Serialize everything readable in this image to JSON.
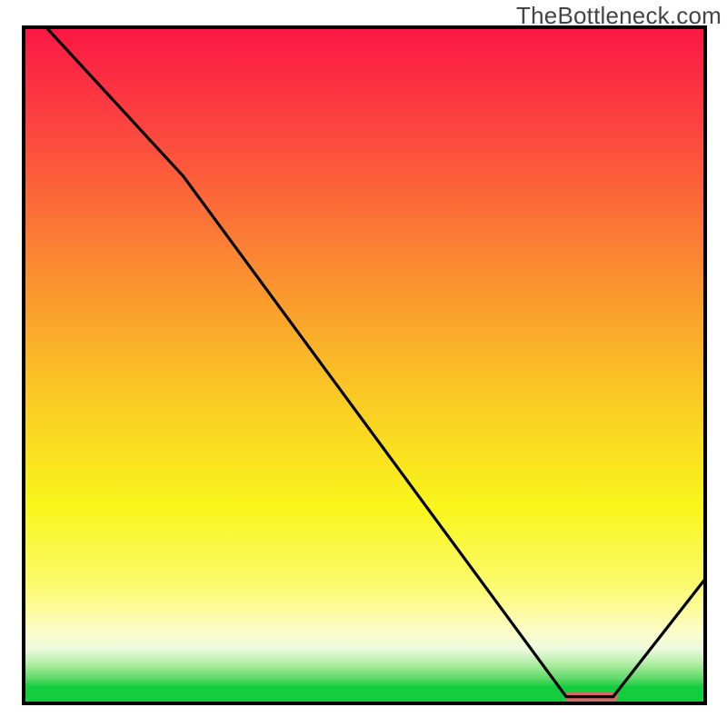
{
  "watermark": "TheBottleneck.com",
  "chart_data": {
    "type": "line",
    "title": "",
    "xlabel": "",
    "ylabel": "",
    "xlim": [
      0,
      100
    ],
    "ylim": [
      0,
      100
    ],
    "grid": false,
    "series": [
      {
        "name": "bottleneck-curve",
        "x": [
          3.3,
          23.4,
          79.6,
          86.5,
          100
        ],
        "y": [
          100.0,
          78.0,
          1.0,
          1.0,
          18.4
        ]
      }
    ],
    "marker": {
      "name": "optimal-range",
      "x_start": 79.4,
      "x_end": 87.2,
      "y": 1.0,
      "color": "#d66a6a"
    },
    "gradient_stops": [
      {
        "pct": 0.0,
        "color": "#fb1745"
      },
      {
        "pct": 14.0,
        "color": "#fc4240"
      },
      {
        "pct": 34.0,
        "color": "#fb8632"
      },
      {
        "pct": 54.0,
        "color": "#fac825"
      },
      {
        "pct": 71.0,
        "color": "#f9f61c"
      },
      {
        "pct": 82.5,
        "color": "#fbfa6d"
      },
      {
        "pct": 89.5,
        "color": "#fdfdcb"
      },
      {
        "pct": 92.0,
        "color": "#ecfade"
      },
      {
        "pct": 94.0,
        "color": "#b6eea7"
      },
      {
        "pct": 96.3,
        "color": "#5fda6a"
      },
      {
        "pct": 97.6,
        "color": "#13cd3f"
      },
      {
        "pct": 100.0,
        "color": "#13cd3f"
      }
    ]
  }
}
